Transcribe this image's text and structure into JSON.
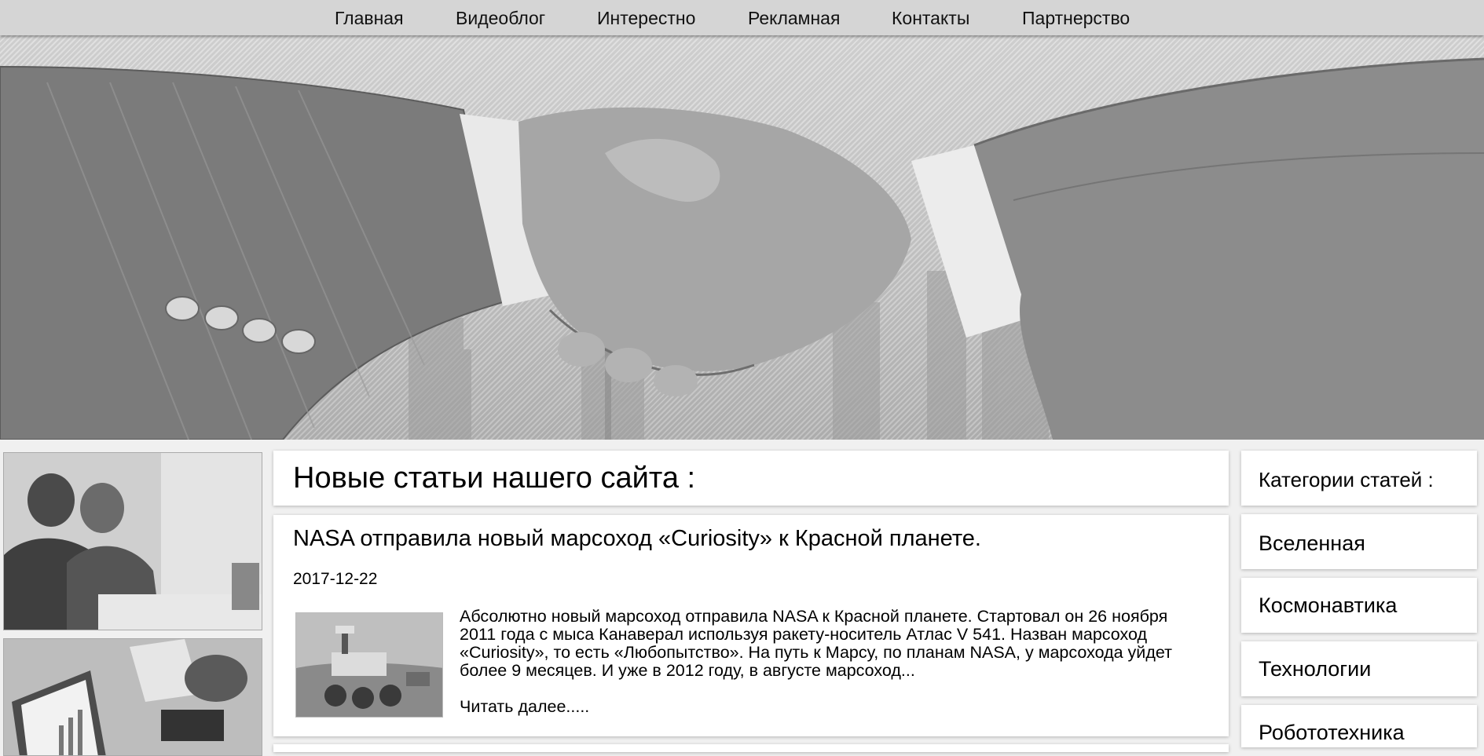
{
  "nav": {
    "items": [
      {
        "label": "Главная"
      },
      {
        "label": "Видеоблог"
      },
      {
        "label": "Интерестно"
      },
      {
        "label": "Рекламная"
      },
      {
        "label": "Контакты"
      },
      {
        "label": "Партнерство"
      }
    ]
  },
  "hero": {
    "image": "handshake-photo"
  },
  "sidebar_left": {
    "thumbs": [
      {
        "image": "business-meeting-photo"
      },
      {
        "image": "laptop-charts-photo"
      }
    ]
  },
  "main": {
    "section_title": "Новые статьи нашего сайта :",
    "articles": [
      {
        "title": "NASA отправила новый марсоход «Curiosity» к Красной планете.",
        "date": "2017-12-22",
        "image": "mars-rover-photo",
        "excerpt": "Абсолютно новый марсоход отправила NASA к Красной планете. Стартовал он 26 ноября 2011 года с мыса Канаверал используя ракету-носитель Атлас V 541. Назван марсоход «Curiosity», то есть «Любопытство». На путь к Марсу, по планам NASA, у марсохода уйдет более 9 месяцев. И уже в 2012 году, в августе марсоход...",
        "read_more": "Читать далее....."
      }
    ]
  },
  "sidebar_right": {
    "title": "Категории статей :",
    "categories": [
      {
        "label": "Вселенная"
      },
      {
        "label": "Космонавтика"
      },
      {
        "label": "Технологии"
      },
      {
        "label": "Робототехника"
      }
    ]
  }
}
